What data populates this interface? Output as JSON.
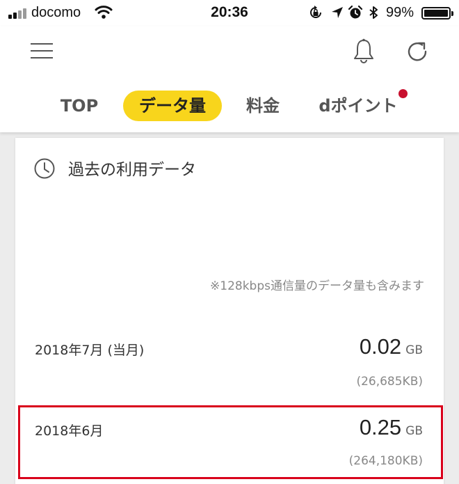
{
  "status_bar": {
    "carrier": "docomo",
    "time": "20:36",
    "battery_percent": "99%",
    "battery_level": 0.99,
    "signal_bars_on": 2,
    "signal_bars_total": 4,
    "icons": [
      "signal-icon",
      "wifi-icon",
      "orientation-lock-icon",
      "location-arrow-icon",
      "alarm-icon",
      "bluetooth-icon",
      "battery-icon"
    ]
  },
  "header": {
    "icons": [
      "menu-icon",
      "bell-icon",
      "refresh-icon"
    ],
    "tabs": [
      {
        "label": "TOP",
        "active": false
      },
      {
        "label": "データ量",
        "active": true
      },
      {
        "label": "料金",
        "active": false
      },
      {
        "label": "dポイント",
        "active": false,
        "has_notification": true
      }
    ]
  },
  "card": {
    "icon": "clock-icon",
    "title": "過去の利用データ",
    "note": "※128kbps通信量のデータ量も含みます",
    "rows": [
      {
        "label": "2018年7月 (当月)",
        "value": "0.02",
        "unit": "GB",
        "kb": "(26,685KB)",
        "highlighted": false
      },
      {
        "label": "2018年6月",
        "value": "0.25",
        "unit": "GB",
        "kb": "(264,180KB)",
        "highlighted": true
      }
    ]
  },
  "colors": {
    "accent_yellow": "#f8d51c",
    "notification_red": "#c8102e",
    "highlight_red": "#d9001b",
    "background": "#ececec"
  }
}
